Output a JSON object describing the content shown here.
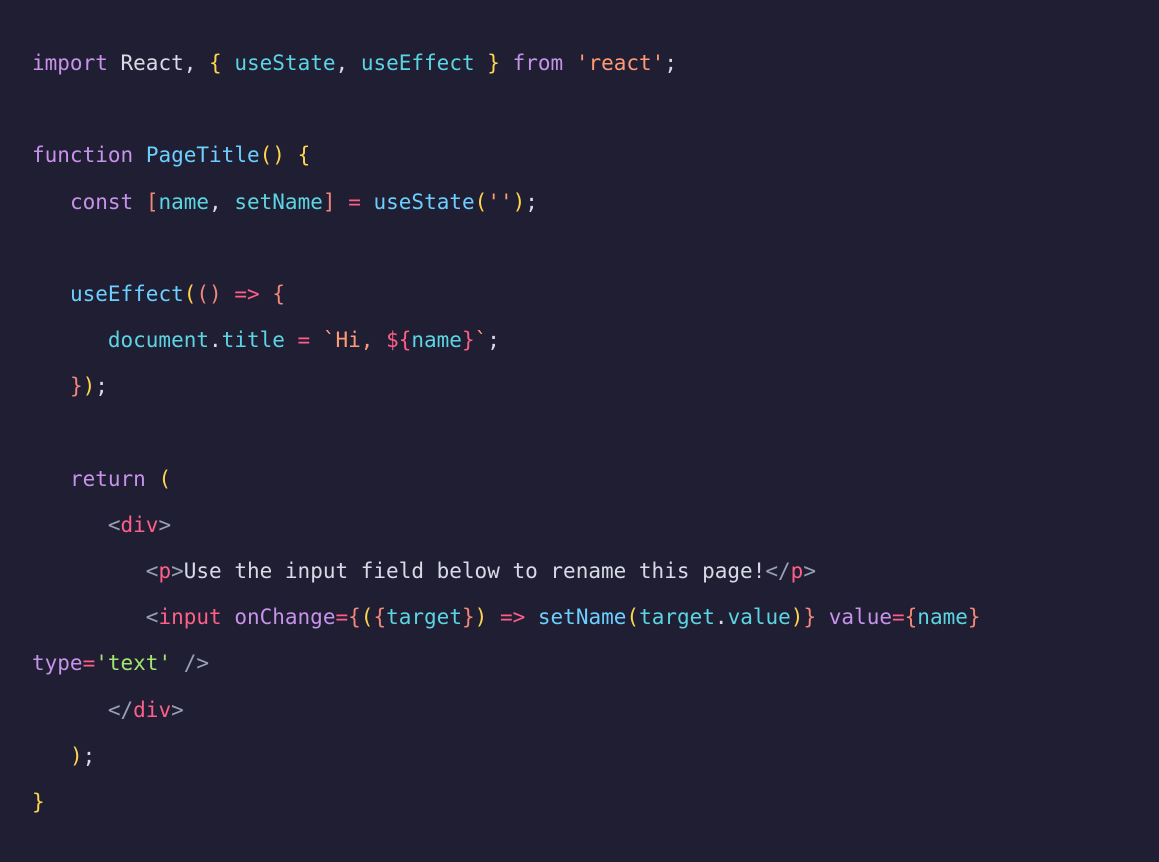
{
  "code": {
    "l1": {
      "import": "import",
      "react": "React",
      "comma": ",",
      "lbrace": "{",
      "useState": "useState",
      "comma2": ",",
      "useEffect": "useEffect",
      "rbrace": "}",
      "from": "from",
      "str": "'react'",
      "semi": ";"
    },
    "l3": {
      "function": "function",
      "name": "PageTitle",
      "parens": "()",
      "lbrace": "{"
    },
    "l4": {
      "const": "const",
      "lbr": "[",
      "name": "name",
      "comma": ",",
      "setName": "setName",
      "rbr": "]",
      "eq": "=",
      "useState": "useState",
      "lp": "(",
      "str": "''",
      "rp": ")",
      "semi": ";"
    },
    "l6": {
      "useEffect": "useEffect",
      "lp": "(",
      "lp2": "(",
      "rp2": ")",
      "arrow": "=>",
      "lbrace": "{"
    },
    "l7": {
      "document": "document",
      "dot": ".",
      "title": "title",
      "eq": "=",
      "tpl_open": "`Hi, ",
      "interp_open": "${",
      "name": "name",
      "interp_close": "}",
      "tpl_close": "`",
      "semi": ";"
    },
    "l8": {
      "rbrace": "}",
      "rp": ")",
      "semi": ";"
    },
    "l10": {
      "return": "return",
      "lp": "("
    },
    "l11": {
      "lt": "<",
      "tag": "div",
      "gt": ">"
    },
    "l12": {
      "lt": "<",
      "tag": "p",
      "gt": ">",
      "text": "Use the input field below to rename this page!",
      "lt2": "</",
      "tag2": "p",
      "gt2": ">"
    },
    "l13": {
      "lt": "<",
      "tag": "input",
      "onChange": "onChange",
      "eq": "=",
      "lbrace": "{",
      "lp": "(",
      "lbrace2": "{",
      "target": "target",
      "rbrace2": "}",
      "rp": ")",
      "arrow": "=>",
      "setName": "setName",
      "lp2": "(",
      "target2": "target",
      "dot": ".",
      "value": "value",
      "rp2": ")",
      "rbrace": "}",
      "valueAttr": "value",
      "eq2": "=",
      "lbrace3": "{",
      "name": "name",
      "rbrace3": "}",
      "typeAttr": "type",
      "eq3": "=",
      "typeStr": "'text'",
      "close": "/>"
    },
    "l14": {
      "lt": "</",
      "tag": "div",
      "gt": ">"
    },
    "l15": {
      "rp": ")",
      "semi": ";"
    },
    "l16": {
      "rbrace": "}"
    }
  }
}
